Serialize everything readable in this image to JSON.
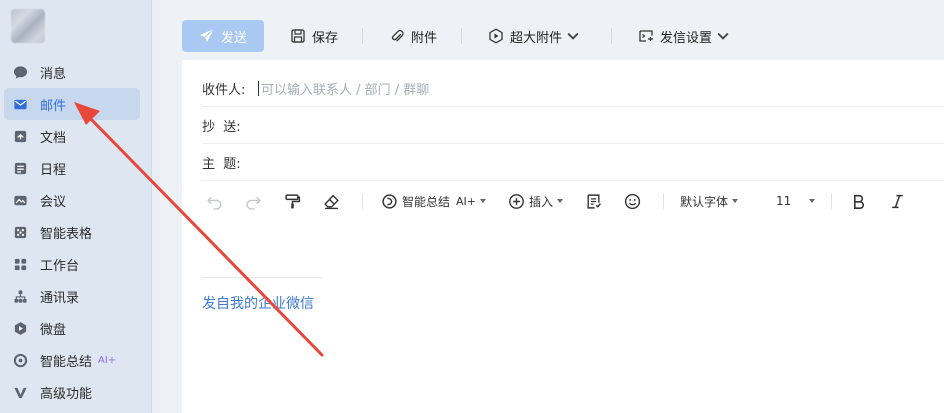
{
  "sidebar": {
    "items": [
      {
        "label": "消息",
        "icon": "chat-bubble-icon",
        "active": false
      },
      {
        "label": "邮件",
        "icon": "mail-icon",
        "active": true
      },
      {
        "label": "文档",
        "icon": "doc-icon",
        "active": false
      },
      {
        "label": "日程",
        "icon": "calendar-icon",
        "active": false
      },
      {
        "label": "会议",
        "icon": "meeting-icon",
        "active": false
      },
      {
        "label": "智能表格",
        "icon": "smart-table-icon",
        "active": false
      },
      {
        "label": "工作台",
        "icon": "workbench-icon",
        "active": false
      },
      {
        "label": "通讯录",
        "icon": "contacts-icon",
        "active": false
      },
      {
        "label": "微盘",
        "icon": "drive-icon",
        "active": false
      },
      {
        "label": "智能总结",
        "icon": "ai-summary-icon",
        "active": false,
        "tag": "AI+"
      },
      {
        "label": "高级功能",
        "icon": "premium-icon",
        "active": false
      }
    ]
  },
  "toolbar": {
    "send_label": "发送",
    "save_label": "保存",
    "attach_label": "附件",
    "big_attach_label": "超大附件",
    "send_settings_label": "发信设置"
  },
  "compose": {
    "to_label": "收件人:",
    "to_placeholder": "可以输入联系人 / 部门 / 群聊",
    "cc_label": "抄  送:",
    "subject_label": "主  题:",
    "signature": "发自我的企业微信"
  },
  "format": {
    "ai_summary_label": "智能总结",
    "ai_tag": "AI+",
    "insert_label": "插入",
    "font_label": "默认字体",
    "font_size": "11"
  },
  "colors": {
    "accent": "#2f6fd6",
    "send_disabled": "#a9c8f2",
    "annotation_arrow": "#e8473b"
  }
}
